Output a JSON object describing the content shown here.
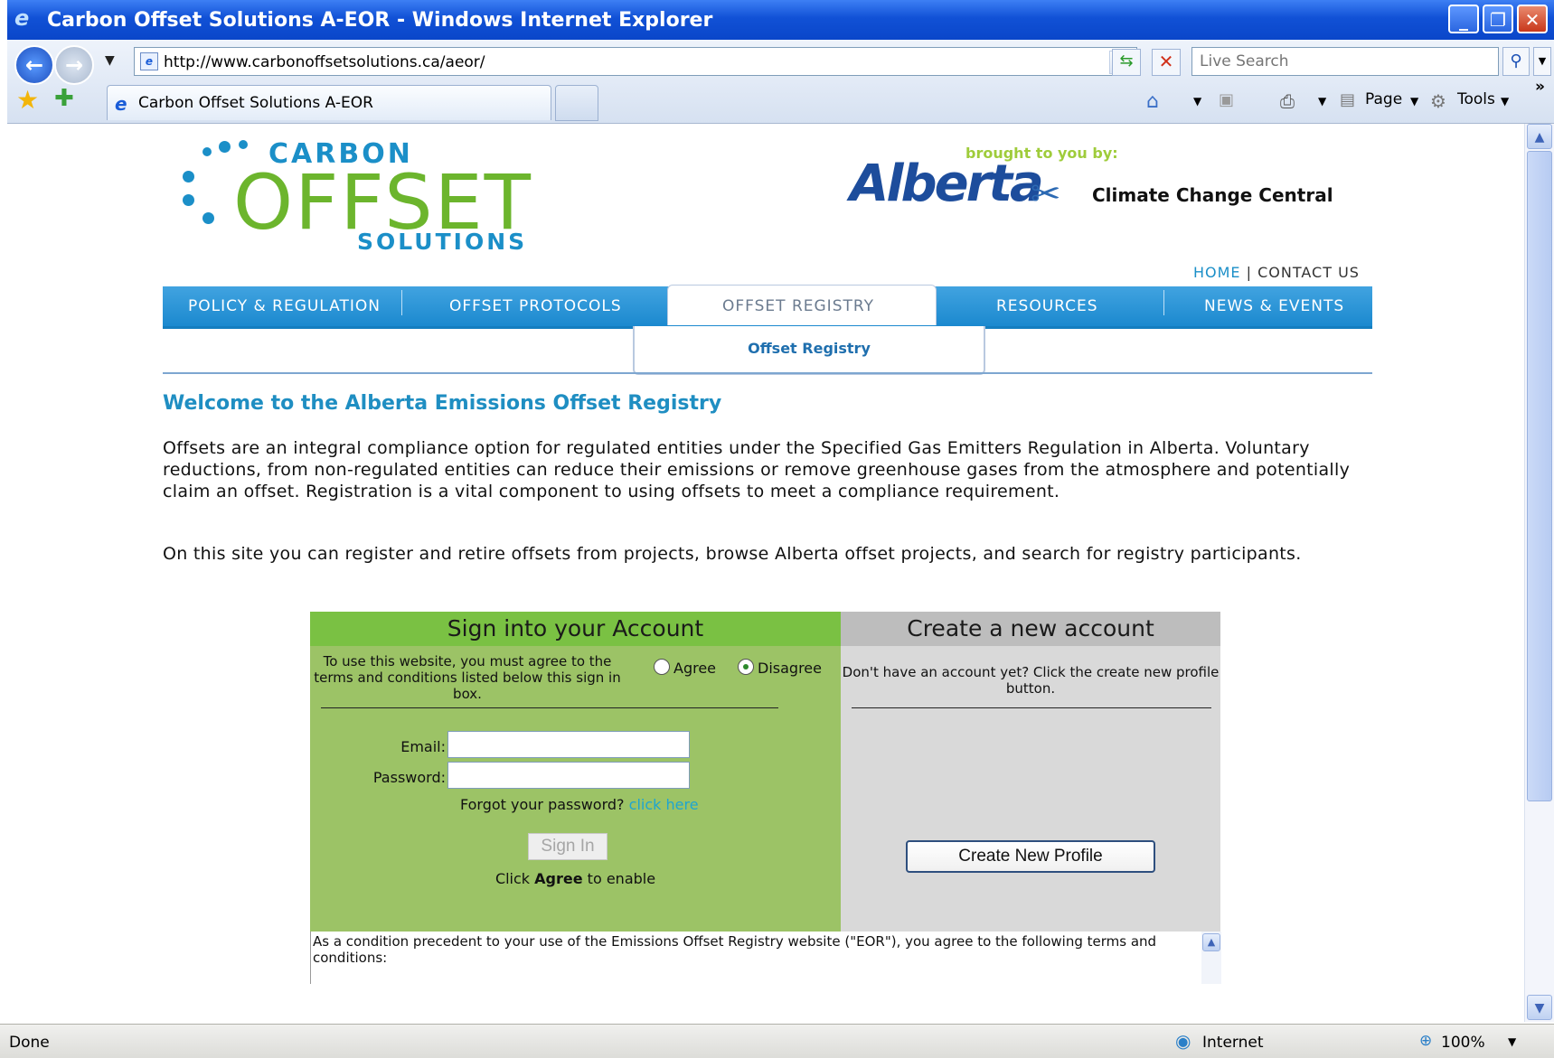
{
  "browser": {
    "window_title": "Carbon Offset Solutions A-EOR - Windows Internet Explorer",
    "url": "http://www.carbonoffsetsolutions.ca/aeor/",
    "search_placeholder": "Live Search",
    "tab_label": "Carbon Offset Solutions A-EOR",
    "cmd_page": "Page",
    "cmd_tools": "Tools",
    "chevron": "»",
    "status_text": "Done",
    "zone": "Internet",
    "zoom": "100%"
  },
  "header": {
    "logo_carbon": "CARBON",
    "logo_offset": "OFFSET",
    "logo_solutions": "SOLUTIONS",
    "brought_by": "brought to you by:",
    "alberta": "Alberta",
    "ccc": "Climate Change Central",
    "home": "HOME",
    "separator": "|",
    "contact": "CONTACT US"
  },
  "nav": {
    "items": [
      "POLICY & REGULATION",
      "OFFSET PROTOCOLS",
      "OFFSET REGISTRY",
      "RESOURCES",
      "NEWS & EVENTS"
    ],
    "sub": "Offset Registry"
  },
  "main": {
    "welcome": "Welcome to the Alberta Emissions Offset Registry",
    "para1": "Offsets are an integral compliance option for regulated entities under the Specified Gas Emitters Regulation in Alberta. Voluntary reductions, from non-regulated entities can reduce their emissions or remove greenhouse gases from the atmosphere and potentially claim an offset. Registration is a vital component to using offsets to meet a compliance requirement.",
    "para2": "On this site you can register and retire offsets from projects, browse Alberta offset projects, and search for registry participants."
  },
  "signin": {
    "heading": "Sign into your Account",
    "note": "To use this website, you must agree to the terms and conditions listed below this sign in box.",
    "agree": "Agree",
    "disagree": "Disagree",
    "selected": "Disagree",
    "email_label": "Email:",
    "password_label": "Password:",
    "forgot": "Forgot your password?",
    "click_here": "click here",
    "button": "Sign In",
    "enable_pre": "Click ",
    "enable_bold": "Agree",
    "enable_post": " to enable"
  },
  "create": {
    "heading": "Create a new account",
    "note": "Don't have an account yet? Click the create new profile button.",
    "button": "Create New Profile"
  },
  "terms": {
    "text": "As a condition precedent to your use of the Emissions Offset Registry website (\"EOR\"), you agree to the following terms and conditions:"
  },
  "colors": {
    "brand_blue": "#1b8fc8",
    "brand_green": "#6cb52d",
    "signin_panel": "#9cc366",
    "create_panel": "#d9d9d9"
  }
}
